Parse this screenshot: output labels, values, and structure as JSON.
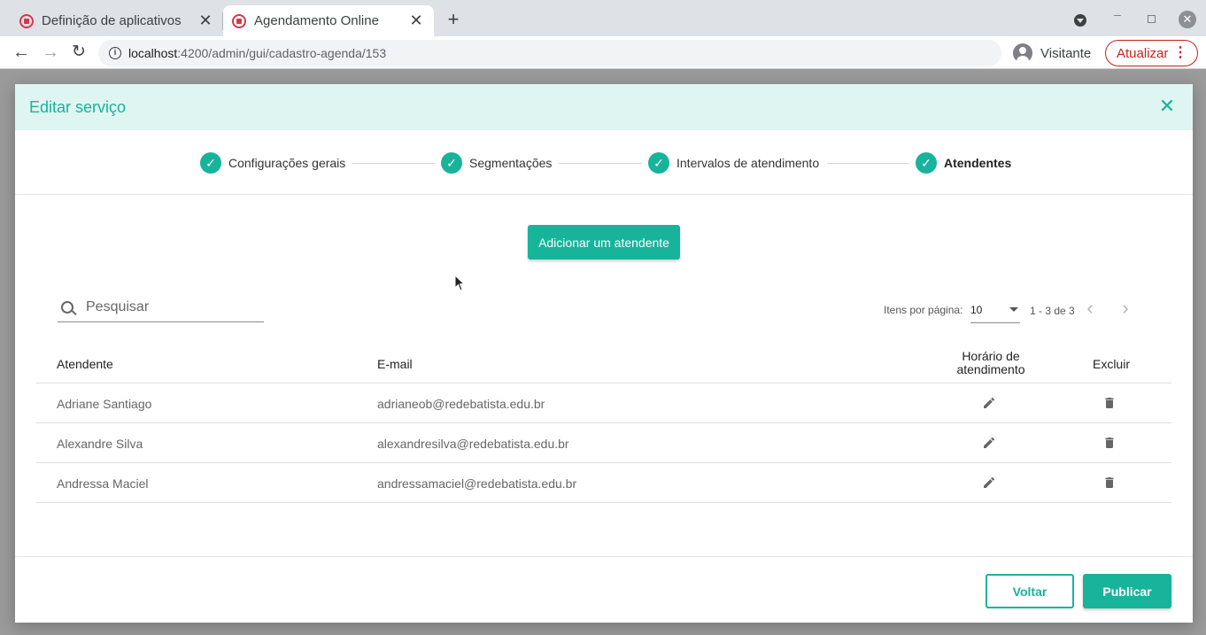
{
  "browser": {
    "tabs": [
      {
        "title": "Definição de aplicativos",
        "active": false
      },
      {
        "title": "Agendamento Online",
        "active": true
      }
    ],
    "new_tab_symbol": "+",
    "close_symbol": "✕",
    "url": {
      "host": "localhost",
      "rest": ":4200/admin/gui/cadastro-agenda/153"
    },
    "profile_label": "Visitante",
    "update_label": "Atualizar",
    "menu_symbol": "⋮"
  },
  "modal": {
    "title": "Editar serviço",
    "close_symbol": "✕",
    "accent_color": "#18b39b",
    "steps": [
      {
        "label": "Configurações gerais",
        "done": true
      },
      {
        "label": "Segmentações",
        "done": true
      },
      {
        "label": "Intervalos de atendimento",
        "done": true
      },
      {
        "label": "Atendentes",
        "done": true,
        "active": true
      }
    ],
    "check_symbol": "✓",
    "add_button_label": "Adicionar um atendente",
    "search": {
      "placeholder": "Pesquisar",
      "value": ""
    },
    "paginator": {
      "items_per_page_label": "Itens por página:",
      "page_size": "10",
      "range_label": "1 - 3 de 3",
      "prev_symbol": "‹",
      "next_symbol": "›"
    },
    "table": {
      "headers": {
        "name": "Atendente",
        "email": "E-mail",
        "schedule": "Horário de atendimento",
        "delete": "Excluir"
      },
      "rows": [
        {
          "name": "Adriane Santiago",
          "email": "adrianeob@redebatista.edu.br"
        },
        {
          "name": "Alexandre Silva",
          "email": "alexandresilva@redebatista.edu.br"
        },
        {
          "name": "Andressa Maciel",
          "email": "andressamaciel@redebatista.edu.br"
        }
      ]
    },
    "footer": {
      "back_label": "Voltar",
      "publish_label": "Publicar"
    }
  }
}
